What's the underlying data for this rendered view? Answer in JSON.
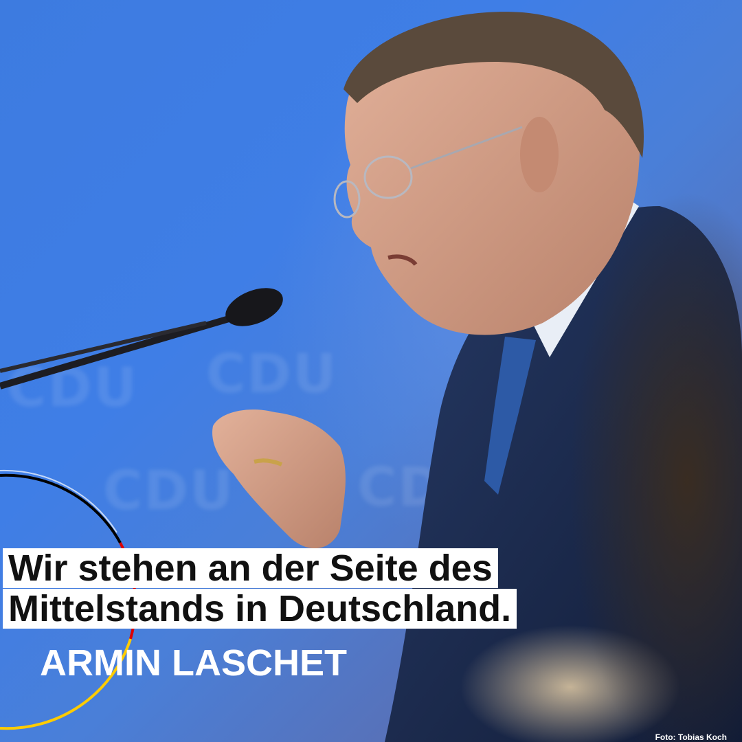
{
  "quote": {
    "line1": "Wir stehen an der Seite des",
    "line2": "Mittelstands in Deutschland."
  },
  "author": "ARMIN LASCHET",
  "photo_credit": "Foto: Tobias Koch",
  "background_logo": "CDU",
  "colors": {
    "background_blue": "#3d7be0",
    "ring_black": "#000000",
    "ring_red": "#dd0000",
    "ring_gold": "#ffcc00",
    "ring_white": "#ffffff",
    "quote_box": "#ffffff",
    "quote_text": "#111111"
  }
}
